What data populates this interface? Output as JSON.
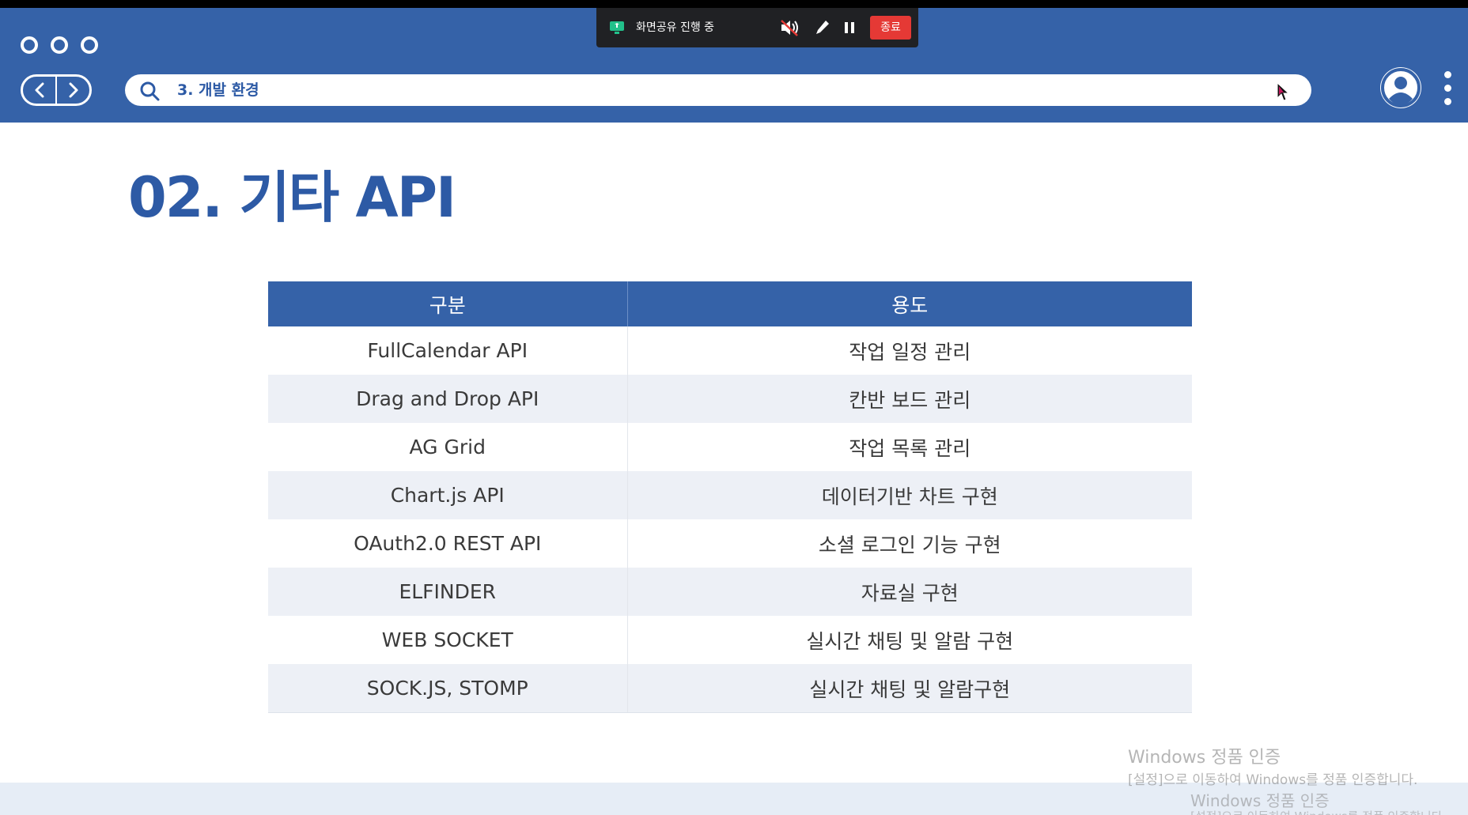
{
  "share_toolbar": {
    "label": "화면공유 진행 중",
    "end_label": "종료",
    "icons": [
      "screen-share-icon",
      "speaker-muted-icon",
      "pen-icon",
      "pause-icon"
    ]
  },
  "browser": {
    "search_text": "3. 개발 환경",
    "icons": [
      "window-dot-icon",
      "back-arrow-icon",
      "forward-arrow-icon",
      "search-icon",
      "user-avatar-icon",
      "more-vertical-icon"
    ]
  },
  "slide": {
    "title": "02. 기타 API",
    "table": {
      "headers": [
        "구분",
        "용도"
      ],
      "rows": [
        [
          "FullCalendar API",
          "작업 일정 관리"
        ],
        [
          "Drag and Drop API",
          "칸반 보드 관리"
        ],
        [
          "AG Grid",
          "작업 목록 관리"
        ],
        [
          "Chart.js API",
          "데이터기반 차트 구현"
        ],
        [
          "OAuth2.0 REST API",
          "소셜 로그인 기능 구현"
        ],
        [
          "ELFINDER",
          "자료실 구현"
        ],
        [
          "WEB SOCKET",
          "실시간 채팅 및 알람 구현"
        ],
        [
          "SOCK.JS, STOMP",
          "실시간 채팅 및 알람구현"
        ]
      ]
    }
  },
  "watermark": {
    "title": "Windows 정품 인증",
    "subtitle": "[설정]으로 이동하여 Windows를 정품 인증합니다.",
    "title_2": "Windows 정품 인증",
    "subtitle_2": "[설정]으로 이동하여 Windows를 정품 인증합니다."
  },
  "colors": {
    "brand_blue": "#3562a8",
    "title_blue": "#2d5aa5",
    "row_alt": "#edf0f6",
    "end_red": "#e53935"
  }
}
